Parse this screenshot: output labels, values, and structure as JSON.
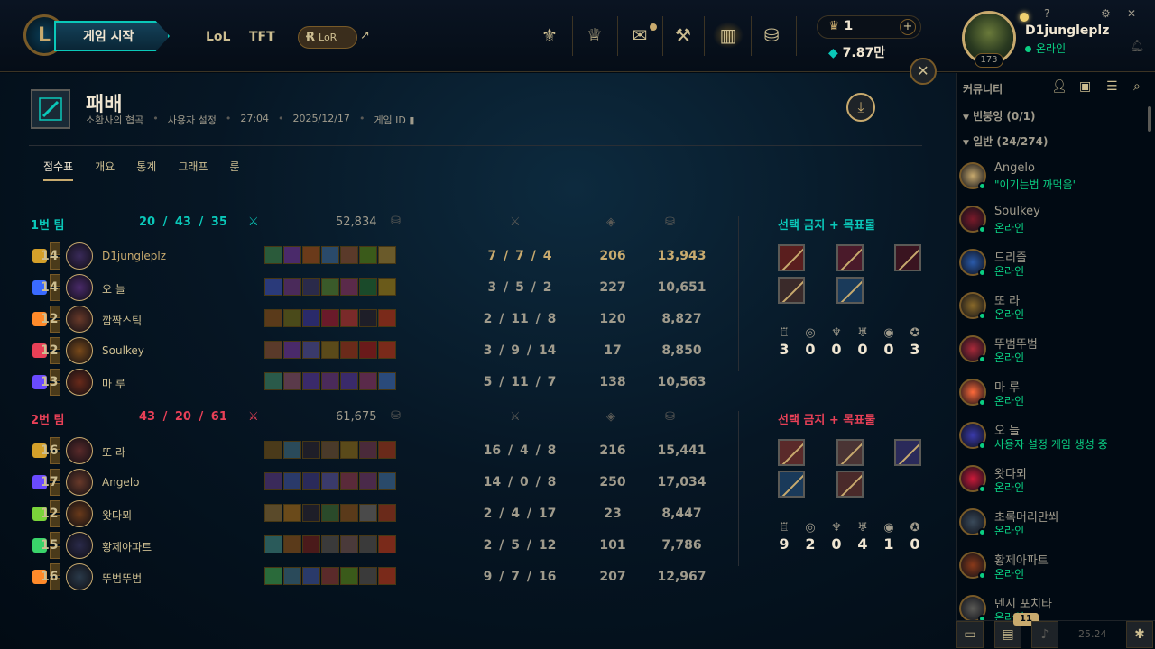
{
  "topbar": {
    "logo": "L",
    "play_button": "게임 시작",
    "nav": [
      "LoL",
      "TFT"
    ],
    "lor_pill": "LoR",
    "external_icon": "↗",
    "icons": [
      "trophy-icon",
      "clash-icon",
      "store-icon",
      "crafting-icon",
      "collection-icon",
      "loot-icon"
    ],
    "currency1": "1",
    "currency2": "7.87만",
    "currency_plus": "+",
    "level": "173",
    "username": "D1jungleplz",
    "status": "온라인",
    "mini": [
      "?",
      "—",
      "⚙",
      "✕"
    ]
  },
  "header": {
    "close": "✕",
    "title": "패배",
    "map": "소환사의 협곡",
    "mode": "사용자 설정",
    "duration": "27:04",
    "date": "2025/12/17",
    "game_id": "게임 ID",
    "download_icon": "⤓",
    "tabs": [
      "점수표",
      "개요",
      "통계",
      "그래프",
      "룬"
    ]
  },
  "team1": {
    "name": "1번 팀",
    "kda": "20 / 43 / 35",
    "gold": "52,834",
    "bans_title": "선택 금지 + 목표물",
    "objectives": [
      "3",
      "0",
      "0",
      "0",
      "0",
      "3"
    ],
    "players": [
      {
        "level": "14",
        "name": "D1jungleplz",
        "kda": "7 / 7 / 4",
        "cs": "206",
        "gold": "13,943",
        "me": true
      },
      {
        "level": "14",
        "name": "오 늘",
        "kda": "3 / 5 / 2",
        "cs": "227",
        "gold": "10,651"
      },
      {
        "level": "12",
        "name": "깜짝스틱",
        "kda": "2 / 11 / 8",
        "cs": "120",
        "gold": "8,827"
      },
      {
        "level": "12",
        "name": "Soulkey",
        "kda": "3 / 9 / 14",
        "cs": "17",
        "gold": "8,850"
      },
      {
        "level": "13",
        "name": "마 루",
        "kda": "5 / 11 / 7",
        "cs": "138",
        "gold": "10,563"
      }
    ]
  },
  "team2": {
    "name": "2번 팀",
    "kda": "43 / 20 / 61",
    "gold": "61,675",
    "bans_title": "선택 금지 + 목표물",
    "objectives": [
      "9",
      "2",
      "0",
      "4",
      "1",
      "0"
    ],
    "players": [
      {
        "level": "16",
        "name": "또 라",
        "kda": "16 / 4 / 8",
        "cs": "216",
        "gold": "15,441"
      },
      {
        "level": "17",
        "name": "Angelo",
        "kda": "14 / 0 / 8",
        "cs": "250",
        "gold": "17,034"
      },
      {
        "level": "12",
        "name": "왓다뫼",
        "kda": "2 / 4 / 17",
        "cs": "23",
        "gold": "8,447"
      },
      {
        "level": "15",
        "name": "황제아파트",
        "kda": "2 / 5 / 12",
        "cs": "101",
        "gold": "7,786"
      },
      {
        "level": "16",
        "name": "뚜범뚜범",
        "kda": "9 / 7 / 16",
        "cs": "207",
        "gold": "12,967"
      }
    ]
  },
  "sidebar": {
    "title": "커뮤니티",
    "group1": "빈붕잉 (0/1)",
    "group2": "일반 (24/274)",
    "friends": [
      {
        "name": "Angelo",
        "status": "\"이기는법 까먹음\""
      },
      {
        "name": "Soulkey",
        "status": "온라인"
      },
      {
        "name": "드리즐",
        "status": "온라인"
      },
      {
        "name": "또 라",
        "status": "온라인"
      },
      {
        "name": "뚜범뚜범",
        "status": "온라인"
      },
      {
        "name": "마 루",
        "status": "온라인"
      },
      {
        "name": "오 늘",
        "status": "사용자 설정 게임 생성 중"
      },
      {
        "name": "왓다뫼",
        "status": "온라인"
      },
      {
        "name": "초록머리만쏴",
        "status": "온라인"
      },
      {
        "name": "황제아파트",
        "status": "온라인"
      },
      {
        "name": "덴지 포치타",
        "status": "온라인"
      }
    ],
    "badge": "11",
    "version": "25.24"
  },
  "colors": {
    "gold": "#c8aa6e",
    "blue": "#0ac8b9",
    "red": "#e84057",
    "online": "#0acf83"
  }
}
